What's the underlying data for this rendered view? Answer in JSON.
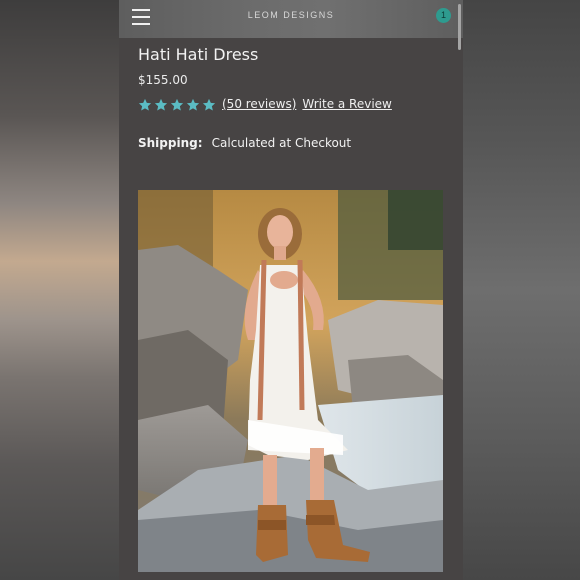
{
  "header": {
    "brand": "LEOM DESIGNS",
    "cart_count": "1",
    "menu_icon": "hamburger-menu-icon"
  },
  "product": {
    "title": "Hati Hati Dress",
    "price": "$155.00",
    "rating": {
      "stars": 5,
      "max_stars": 5,
      "star_color": "#5bbcc4",
      "reviews_link": "(50 reviews)",
      "write_review": "Write a Review"
    },
    "shipping": {
      "label": "Shipping:",
      "value": "Calculated at Checkout"
    }
  },
  "colors": {
    "page_bg": "#474444",
    "header_bg": "#6a6a6a",
    "accent": "#2e9b8f",
    "text": "#f2f2f2"
  }
}
